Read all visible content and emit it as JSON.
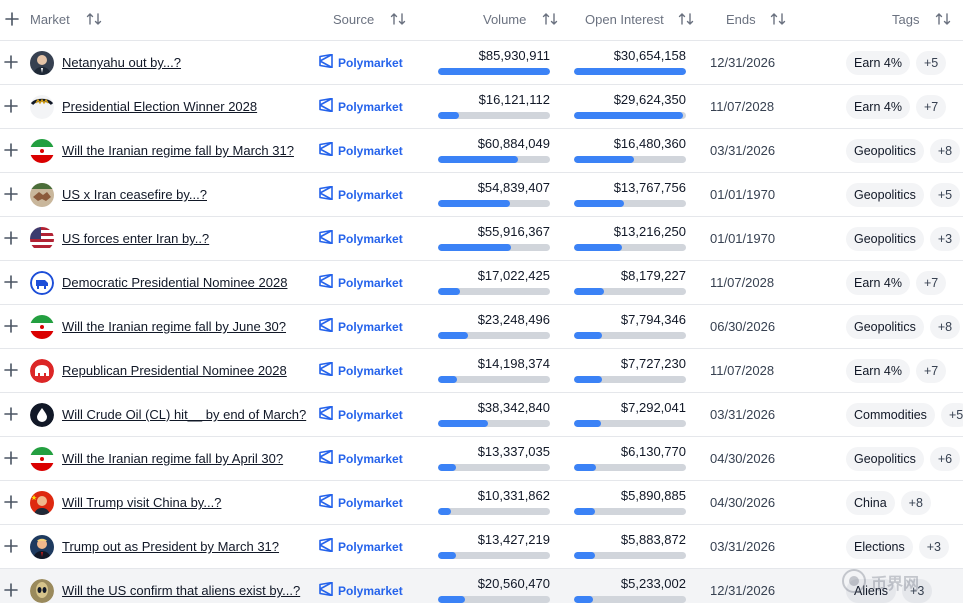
{
  "header": {
    "market": "Market",
    "source": "Source",
    "volume": "Volume",
    "open_interest": "Open Interest",
    "ends": "Ends",
    "tags": "Tags"
  },
  "rows": [
    {
      "market": "Netanyahu out by...?",
      "source": "Polymarket",
      "volume": "$85,930,911",
      "volume_fill": 1.0,
      "oi": "$30,654,158",
      "oi_fill": 1.0,
      "ends": "12/31/2026",
      "tag": "Earn 4%",
      "more": "+5",
      "avatar": "portrait"
    },
    {
      "market": "Presidential Election Winner 2028",
      "source": "Polymarket",
      "volume": "$16,121,112",
      "volume_fill": 0.19,
      "oi": "$29,624,350",
      "oi_fill": 0.97,
      "ends": "11/07/2028",
      "tag": "Earn 4%",
      "more": "+7",
      "avatar": "seal"
    },
    {
      "market": "Will the Iranian regime fall by March 31?",
      "source": "Polymarket",
      "volume": "$60,884,049",
      "volume_fill": 0.71,
      "oi": "$16,480,360",
      "oi_fill": 0.54,
      "ends": "03/31/2026",
      "tag": "Geopolitics",
      "more": "+8",
      "avatar": "iran-flag"
    },
    {
      "market": "US x Iran ceasefire by...?",
      "source": "Polymarket",
      "volume": "$54,839,407",
      "volume_fill": 0.64,
      "oi": "$13,767,756",
      "oi_fill": 0.45,
      "ends": "01/01/1970",
      "tag": "Geopolitics",
      "more": "+5",
      "avatar": "handshake"
    },
    {
      "market": "US forces enter Iran by..?",
      "source": "Polymarket",
      "volume": "$55,916,367",
      "volume_fill": 0.65,
      "oi": "$13,216,250",
      "oi_fill": 0.43,
      "ends": "01/01/1970",
      "tag": "Geopolitics",
      "more": "+3",
      "avatar": "us-flag"
    },
    {
      "market": "Democratic Presidential Nominee 2028",
      "source": "Polymarket",
      "volume": "$17,022,425",
      "volume_fill": 0.2,
      "oi": "$8,179,227",
      "oi_fill": 0.27,
      "ends": "11/07/2028",
      "tag": "Earn 4%",
      "more": "+7",
      "avatar": "democrat"
    },
    {
      "market": "Will the Iranian regime fall by June 30?",
      "source": "Polymarket",
      "volume": "$23,248,496",
      "volume_fill": 0.27,
      "oi": "$7,794,346",
      "oi_fill": 0.25,
      "ends": "06/30/2026",
      "tag": "Geopolitics",
      "more": "+8",
      "avatar": "iran-flag"
    },
    {
      "market": "Republican Presidential Nominee 2028",
      "source": "Polymarket",
      "volume": "$14,198,374",
      "volume_fill": 0.17,
      "oi": "$7,727,230",
      "oi_fill": 0.25,
      "ends": "11/07/2028",
      "tag": "Earn 4%",
      "more": "+7",
      "avatar": "republican"
    },
    {
      "market": "Will Crude Oil (CL) hit__ by end of March?",
      "source": "Polymarket",
      "volume": "$38,342,840",
      "volume_fill": 0.45,
      "oi": "$7,292,041",
      "oi_fill": 0.24,
      "ends": "03/31/2026",
      "tag": "Commodities",
      "more": "+5",
      "avatar": "oil-drop"
    },
    {
      "market": "Will the Iranian regime fall by April 30?",
      "source": "Polymarket",
      "volume": "$13,337,035",
      "volume_fill": 0.16,
      "oi": "$6,130,770",
      "oi_fill": 0.2,
      "ends": "04/30/2026",
      "tag": "Geopolitics",
      "more": "+6",
      "avatar": "iran-flag"
    },
    {
      "market": "Will Trump visit China by...?",
      "source": "Polymarket",
      "volume": "$10,331,862",
      "volume_fill": 0.12,
      "oi": "$5,890,885",
      "oi_fill": 0.19,
      "ends": "04/30/2026",
      "tag": "China",
      "more": "+8",
      "avatar": "china-flag"
    },
    {
      "market": "Trump out as President by March 31?",
      "source": "Polymarket",
      "volume": "$13,427,219",
      "volume_fill": 0.16,
      "oi": "$5,883,872",
      "oi_fill": 0.19,
      "ends": "03/31/2026",
      "tag": "Elections",
      "more": "+3",
      "avatar": "portrait-dark"
    },
    {
      "market": "Will the US confirm that aliens exist by...?",
      "source": "Polymarket",
      "volume": "$20,560,470",
      "volume_fill": 0.24,
      "oi": "$5,233,002",
      "oi_fill": 0.17,
      "ends": "12/31/2026",
      "tag": "Aliens",
      "more": "+3",
      "avatar": "alien"
    }
  ],
  "watermark": {
    "text": "币界网",
    "icon": "coin-logo-icon"
  },
  "colors": {
    "accent": "#2563eb",
    "bar_fill": "#3b82f6",
    "bar_track": "#d1d5db"
  }
}
